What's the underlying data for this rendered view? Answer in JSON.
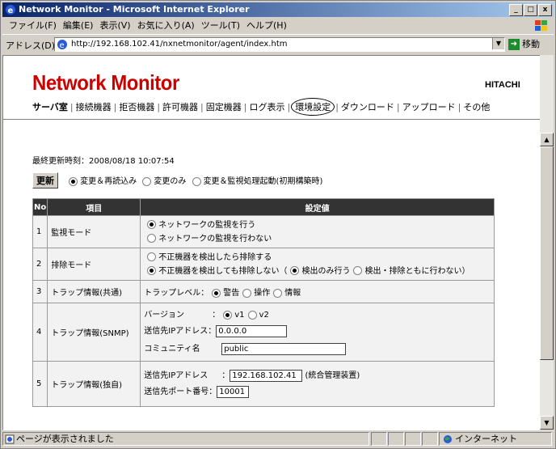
{
  "window": {
    "title": "Network Monitor - Microsoft Internet Explorer"
  },
  "menu": [
    "ファイル(F)",
    "編集(E)",
    "表示(V)",
    "お気に入り(A)",
    "ツール(T)",
    "ヘルプ(H)"
  ],
  "address": {
    "label": "アドレス(D)",
    "url": "http://192.168.102.41/nxnetmonitor/agent/index.htm",
    "go": "移動"
  },
  "header": {
    "brand": "Network Monitor",
    "vendor": "HITACHI"
  },
  "nav": [
    "サーバ室",
    "接続機器",
    "拒否機器",
    "許可機器",
    "固定機器",
    "ログ表示",
    "環境設定",
    "ダウンロード",
    "アップロード",
    "その他"
  ],
  "last_update": "最終更新時刻：2008/08/18 10:07:54",
  "update": {
    "button": "更新",
    "options": [
      "変更＆再読込み",
      "変更のみ",
      "変更＆監視処理起動(初期構築時)"
    ]
  },
  "table": {
    "headers": [
      "No",
      "項目",
      "設定値"
    ],
    "rows": [
      {
        "no": "1",
        "item": "監視モード",
        "opts": [
          "ネットワークの監視を行う",
          "ネットワークの監視を行わない"
        ]
      },
      {
        "no": "2",
        "item": "排除モード",
        "opts": [
          "不正機器を検出したら排除する",
          "不正機器を検出しても排除しない（"
        ],
        "sub": [
          "検出のみ行う",
          "検出・排除ともに行わない）"
        ]
      },
      {
        "no": "3",
        "item": "トラップ情報(共通)",
        "label": "トラップレベル：",
        "opts": [
          "警告",
          "操作",
          "情報"
        ]
      },
      {
        "no": "4",
        "item": "トラップ情報(SNMP)",
        "version_label": "バージョン",
        "version_opts": [
          "v1",
          "v2"
        ],
        "ip_label": "送信先IPアドレス：",
        "ip": "0.0.0.0",
        "community_label": "コミュニティ名",
        "community": "public"
      },
      {
        "no": "5",
        "item": "トラップ情報(独自)",
        "ip_label": "送信先IPアドレス",
        "ip": "192.168.102.41",
        "ip_note": "(統合管理装置)",
        "port_label": "送信先ポート番号：",
        "port": "10001"
      }
    ]
  },
  "status": {
    "text": "ページが表示されました",
    "zone": "インターネット"
  }
}
